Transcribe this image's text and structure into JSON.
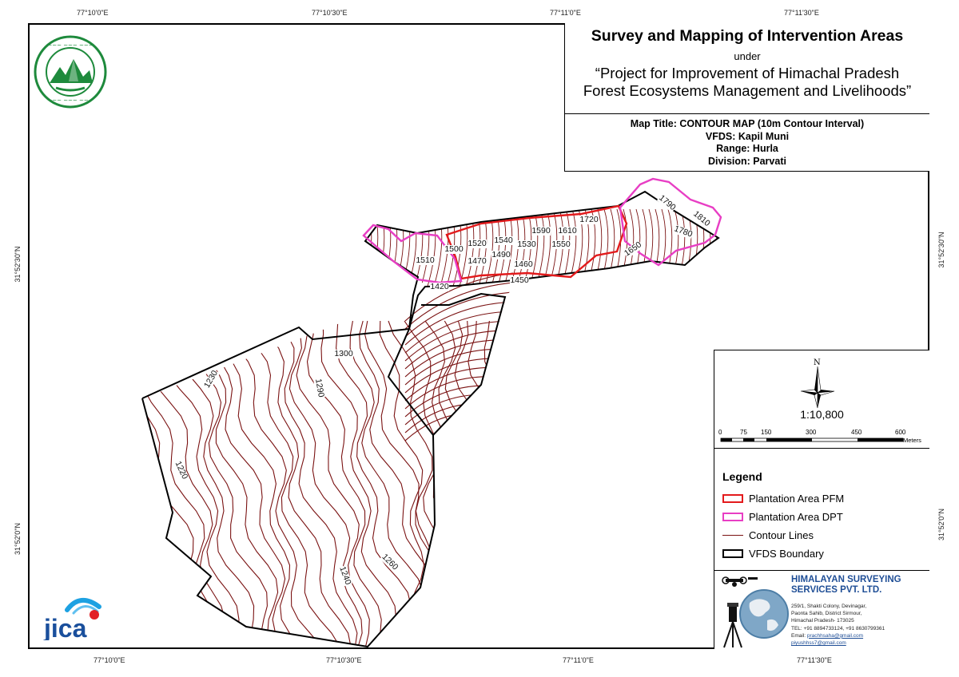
{
  "title": {
    "main": "Survey and Mapping of Intervention Areas",
    "under": "under",
    "project_line1": "“Project for Improvement of Himachal Pradesh",
    "project_line2": "Forest Ecosystems Management and Livelihoods”"
  },
  "map_info": {
    "map_title": "Map Title: CONTOUR MAP (10m Contour Interval)",
    "vfds": "VFDS: Kapil Muni",
    "range": "Range: Hurla",
    "division": "Division: Parvati"
  },
  "graticule": {
    "top": [
      "77°10'0\"E",
      "77°10'30\"E",
      "77°11'0\"E",
      "77°11'30\"E"
    ],
    "bottom": [
      "77°10'0\"E",
      "77°10'30\"E",
      "77°11'0\"E",
      "77°11'30\"E"
    ],
    "left": [
      "31°52'30\"N",
      "31°52'0\"N"
    ],
    "right": [
      "31°52'30\"N",
      "31°52'0\"N"
    ]
  },
  "north_arrow": {
    "label": "N"
  },
  "scale": {
    "ratio": "1:10,800",
    "ticks": [
      "0",
      "75",
      "150",
      "300",
      "450",
      "600"
    ],
    "unit": "Meters"
  },
  "legend": {
    "title": "Legend",
    "items": [
      {
        "label": "Plantation Area PFM",
        "color": "#e31a1c"
      },
      {
        "label": "Plantation Area DPT",
        "color": "#e83ec4"
      },
      {
        "label": "Contour Lines",
        "color": "#7a1212"
      },
      {
        "label": "VFDS Boundary",
        "color": "#000000"
      }
    ]
  },
  "company": {
    "name_line1": "HIMALAYAN SURVEYING",
    "name_line2": "SERVICES PVT. LTD.",
    "addr1": "259/1, Shakti Colony, Devinagar,",
    "addr2": "Paonta Sahib, District Sirmour,",
    "addr3": "Himachal Pradesh- 173025",
    "tel": "TEL: +91 8894733124, +91 8630799361",
    "email": "Email: prachhsaha@gmail.com,",
    "email2": "piyushhss7@gmail.com"
  },
  "logos": {
    "forest_dept": "forest-department-emblem",
    "jica": "jica"
  },
  "contour_labels": [
    "1510",
    "1500",
    "1520",
    "1540",
    "1530",
    "1590",
    "1610",
    "1720",
    "1790",
    "1810",
    "1780",
    "1650",
    "1550",
    "1490",
    "1470",
    "1460",
    "1450",
    "1420",
    "1300",
    "1290",
    "1230",
    "1220",
    "1260",
    "1240"
  ],
  "colors": {
    "contour": "#7a1212",
    "pfm": "#e31a1c",
    "dpt": "#e83ec4",
    "company_blue": "#1f4e96"
  }
}
